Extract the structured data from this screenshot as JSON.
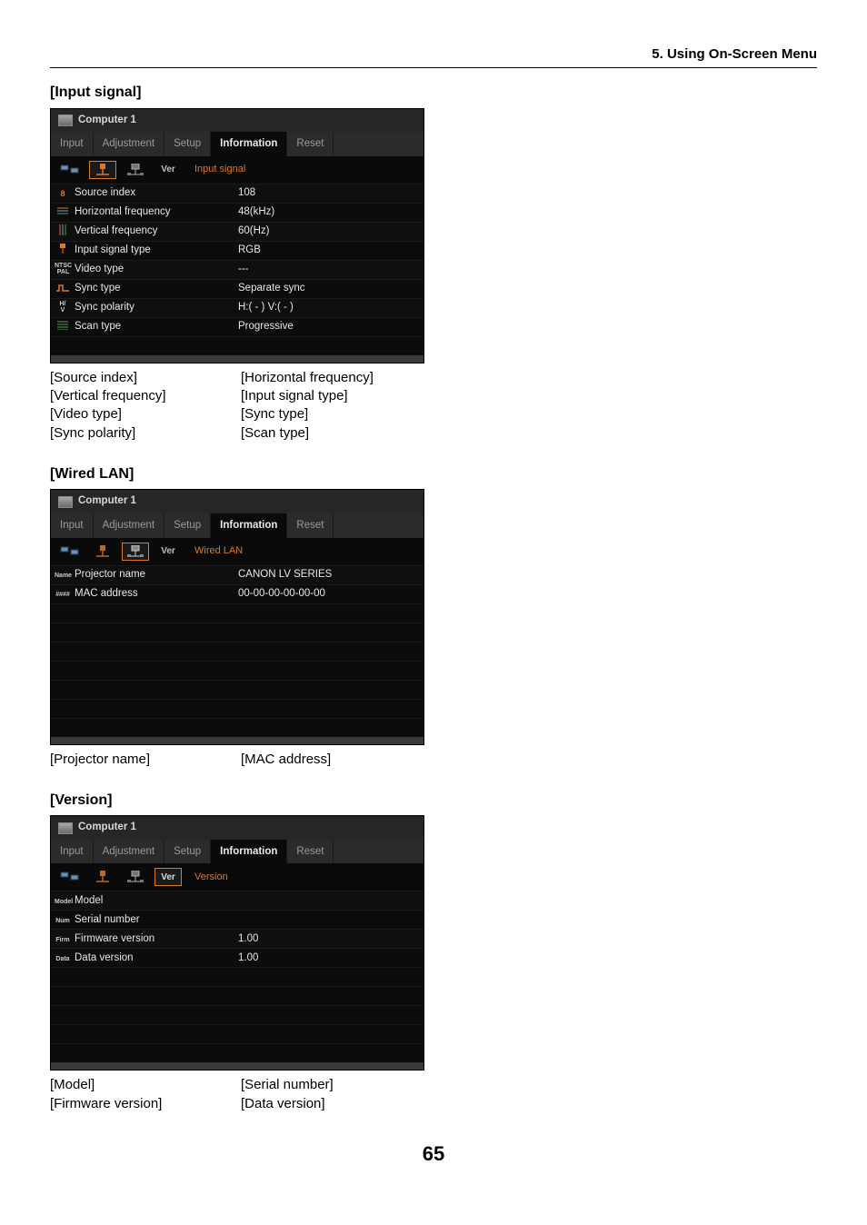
{
  "header": {
    "right": "5. Using On-Screen Menu"
  },
  "page_number": "65",
  "sections": [
    {
      "title": "[Input signal]",
      "menu": {
        "title": "Computer 1",
        "tabs": [
          "Input",
          "Adjustment",
          "Setup",
          "Information",
          "Reset"
        ],
        "selected_tab": "Information",
        "sub_selected_index": 1,
        "sub_label": "Input signal",
        "rows": [
          {
            "icon": "8",
            "label": "Source index",
            "value": "108"
          },
          {
            "icon": "h-icon",
            "label": "Horizontal frequency",
            "value": "48(kHz)"
          },
          {
            "icon": "v-icon",
            "label": "Vertical frequency",
            "value": "60(Hz)"
          },
          {
            "icon": "sig-icon",
            "label": "Input signal type",
            "value": "RGB"
          },
          {
            "icon": "ntsc-icon",
            "icon_text": "NTSC\nPAL",
            "label": "Video type",
            "value": "---"
          },
          {
            "icon": "sync-icon",
            "label": "Sync type",
            "value": "Separate sync"
          },
          {
            "icon": "hv-icon",
            "icon_text": "H/\nV",
            "label": "Sync polarity",
            "value": "H:( - )  V:( - )"
          },
          {
            "icon": "scan-icon",
            "label": "Scan type",
            "value": "Progressive"
          }
        ],
        "pad_rows": 1
      },
      "below_cols": [
        [
          "[Source index]",
          "[Vertical frequency]",
          "[Video type]",
          "[Sync polarity]"
        ],
        [
          "[Horizontal frequency]",
          "[Input signal type]",
          "[Sync type]",
          "[Scan type]"
        ]
      ]
    },
    {
      "title": "[Wired LAN]",
      "menu": {
        "title": "Computer 1",
        "tabs": [
          "Input",
          "Adjustment",
          "Setup",
          "Information",
          "Reset"
        ],
        "selected_tab": "Information",
        "sub_selected_index": 2,
        "sub_label": "Wired LAN",
        "rows": [
          {
            "icon": "name-icon",
            "icon_text": "Name",
            "label": "Projector name",
            "value": "CANON LV SERIES"
          },
          {
            "icon": "mac-icon",
            "icon_text": "####",
            "label": "MAC address",
            "value": "00-00-00-00-00-00"
          }
        ],
        "pad_rows": 7
      },
      "below_cols": [
        [
          "[Projector name]"
        ],
        [
          "[MAC address]"
        ]
      ]
    },
    {
      "title": "[Version]",
      "menu": {
        "title": "Computer 1",
        "tabs": [
          "Input",
          "Adjustment",
          "Setup",
          "Information",
          "Reset"
        ],
        "selected_tab": "Information",
        "sub_selected_index": 3,
        "sub_label": "Version",
        "rows": [
          {
            "icon": "model-icon",
            "icon_text": "Model",
            "label": "Model",
            "value": ""
          },
          {
            "icon": "num-icon",
            "icon_text": "Num",
            "label": "Serial number",
            "value": ""
          },
          {
            "icon": "firm-icon",
            "icon_text": "Firm",
            "label": "Firmware version",
            "value": "1.00"
          },
          {
            "icon": "data-icon",
            "icon_text": "Data",
            "label": "Data version",
            "value": "1.00"
          }
        ],
        "pad_rows": 5
      },
      "below_cols": [
        [
          "[Model]",
          "[Firmware version]"
        ],
        [
          "[Serial number]",
          "[Data version]"
        ]
      ]
    }
  ],
  "subtab_icons": [
    "devices-icon",
    "signal-icon",
    "lan-icon",
    "ver-icon"
  ]
}
